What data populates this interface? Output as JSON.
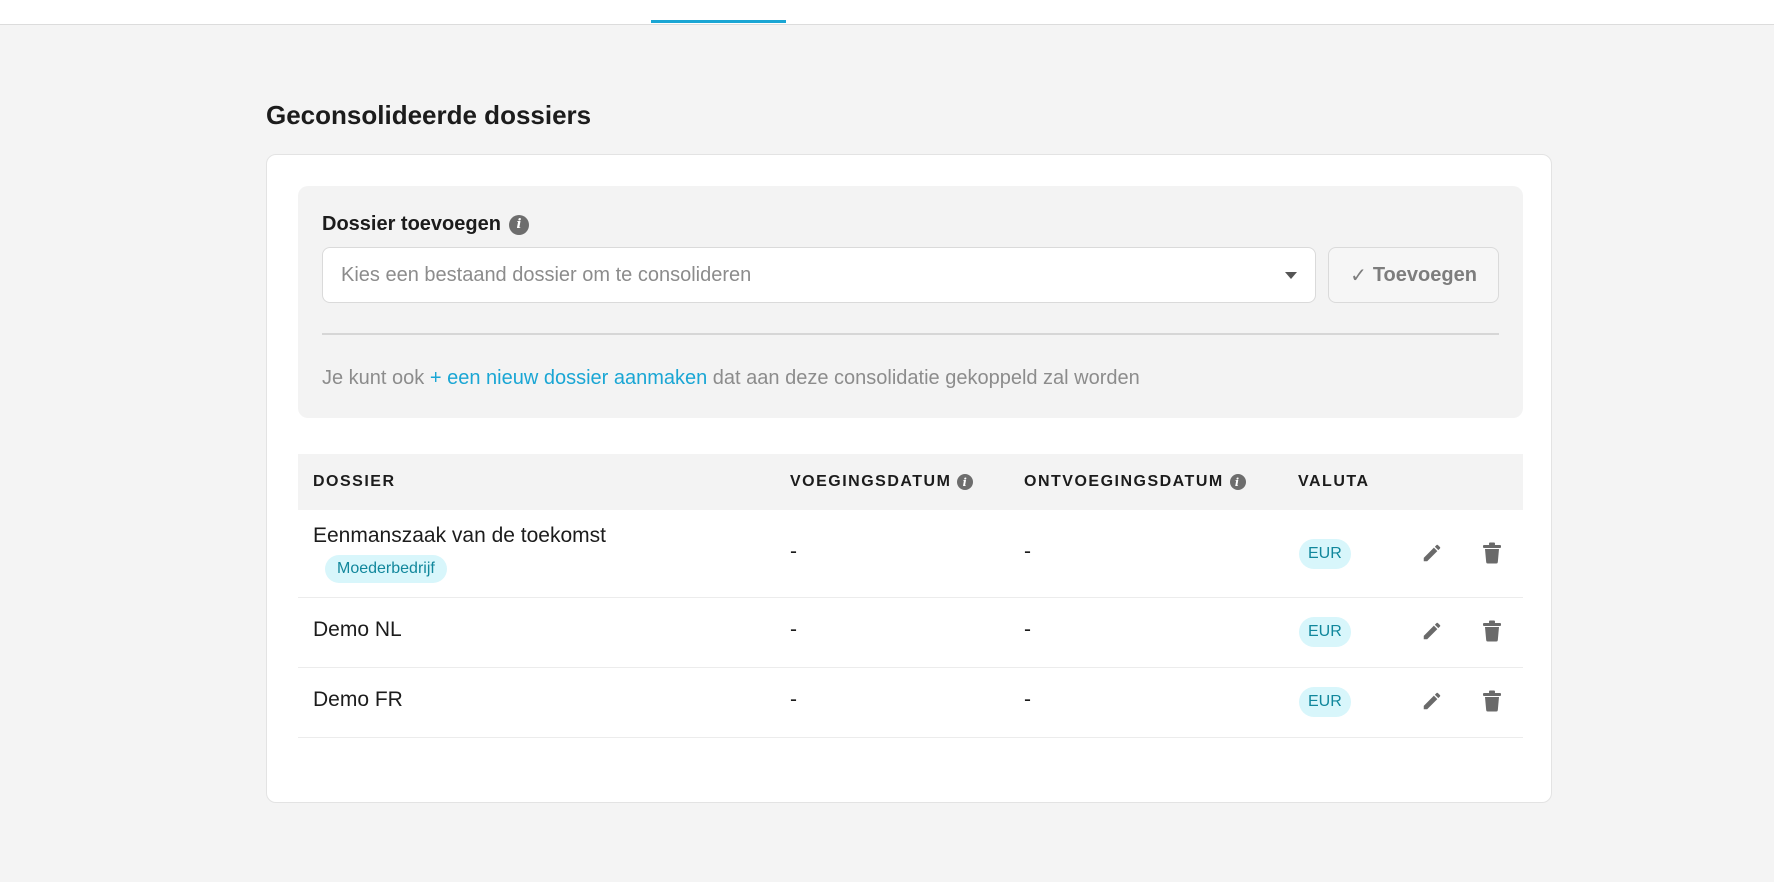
{
  "page": {
    "title": "Geconsolideerde dossiers"
  },
  "colors": {
    "accent": "#1aa6d4",
    "badge_bg": "#d8f6fb",
    "badge_text": "#11879c"
  },
  "add_dossier": {
    "label": "Dossier toevoegen",
    "select_placeholder": "Kies een bestaand dossier om te consolideren",
    "button_label": "Toevoegen",
    "helper_prefix": "Je kunt ook ",
    "helper_link": "+ een nieuw dossier aanmaken",
    "helper_suffix": " dat aan deze consolidatie gekoppeld zal worden"
  },
  "table": {
    "columns": {
      "dossier": "DOSSIER",
      "join_date": "VOEGINGSDATUM",
      "leave_date": "ONTVOEGINGSDATUM",
      "currency": "VALUTA"
    },
    "rows": [
      {
        "name": "Eenmanszaak van de toekomst",
        "badge": "Moederbedrijf",
        "join_date": "-",
        "leave_date": "-",
        "currency": "EUR"
      },
      {
        "name": "Demo NL",
        "join_date": "-",
        "leave_date": "-",
        "currency": "EUR"
      },
      {
        "name": "Demo FR",
        "join_date": "-",
        "leave_date": "-",
        "currency": "EUR"
      }
    ]
  },
  "icons": {
    "info": "info-icon",
    "check": "check-icon",
    "caret": "chevron-down-icon",
    "edit": "pencil-icon",
    "delete": "trash-icon"
  }
}
